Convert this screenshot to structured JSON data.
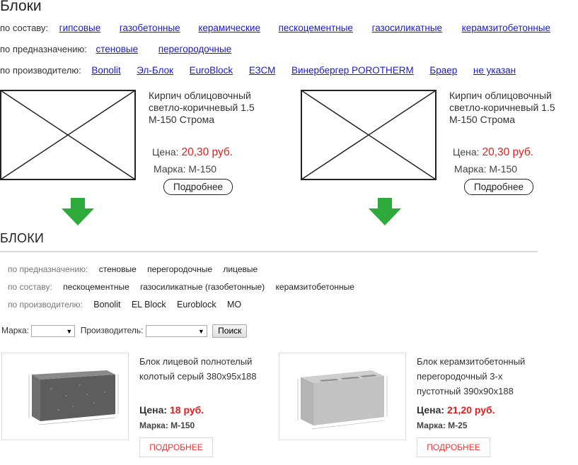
{
  "old": {
    "title": "Блоки",
    "composition": {
      "label": "по составу:",
      "items": [
        "гипсовые",
        "газобетонные",
        "керамические",
        "пескоцементные",
        "газосиликатные",
        "керамзитобетонные"
      ]
    },
    "purpose": {
      "label": "по предназначению:",
      "items": [
        "стеновые",
        "перегородочные"
      ]
    },
    "manufacturer": {
      "label": "по производителю:",
      "items": [
        "Bonolit",
        "Эл-Блок",
        "EuroBlock",
        "ЕЗСМ",
        "Винербергер POROTHERM",
        "Браер",
        "не указан"
      ]
    },
    "cards": [
      {
        "title": "Кирпич облицовочный светло-коричневый 1.5 М-150 Строма",
        "price_label": "Цена:",
        "price": "20,30 руб.",
        "brand": "Марка: М-150",
        "more": "Подробнее"
      },
      {
        "title": "Кирпич облицовочный светло-коричневый 1.5 М-150 Строма",
        "price_label": "Цена:",
        "price": "20,30 руб.",
        "brand": "Марка: М-150",
        "more": "Подробнее"
      }
    ]
  },
  "colors": {
    "arrow": "#2eaa3c",
    "price": "#e01e1e",
    "link": "#1a1acc"
  },
  "new": {
    "title": "БЛОКИ",
    "purpose": {
      "label": "по предназначению:",
      "items": [
        "стеновые",
        "перегородочные",
        "лицевые"
      ]
    },
    "composition": {
      "label": "по составу:",
      "items": [
        "пескоцементные",
        "газосиликатные (газобетонные)",
        "керамзитобетонные"
      ]
    },
    "manufacturer": {
      "label": "по производителю:",
      "items": [
        "Bonolit",
        "EL Block",
        "Euroblock",
        "МО"
      ]
    },
    "filter": {
      "brand_label": "Марка:",
      "maker_label": "Производитель:",
      "search": "Поиск"
    },
    "cards": [
      {
        "title": "Блок лицевой полнотелый колотый серый 380х95х188",
        "price_label": "Цена:",
        "price": "18 руб.",
        "brand": "Марка: М-150",
        "more": "ПОДРОБНЕЕ"
      },
      {
        "title": "Блок керамзитобетонный перегородочный 3-х пустотный 390х90х188",
        "price_label": "Цена:",
        "price": "21,20 руб.",
        "brand": "Марка: М-25",
        "more": "ПОДРОБНЕЕ"
      }
    ]
  }
}
